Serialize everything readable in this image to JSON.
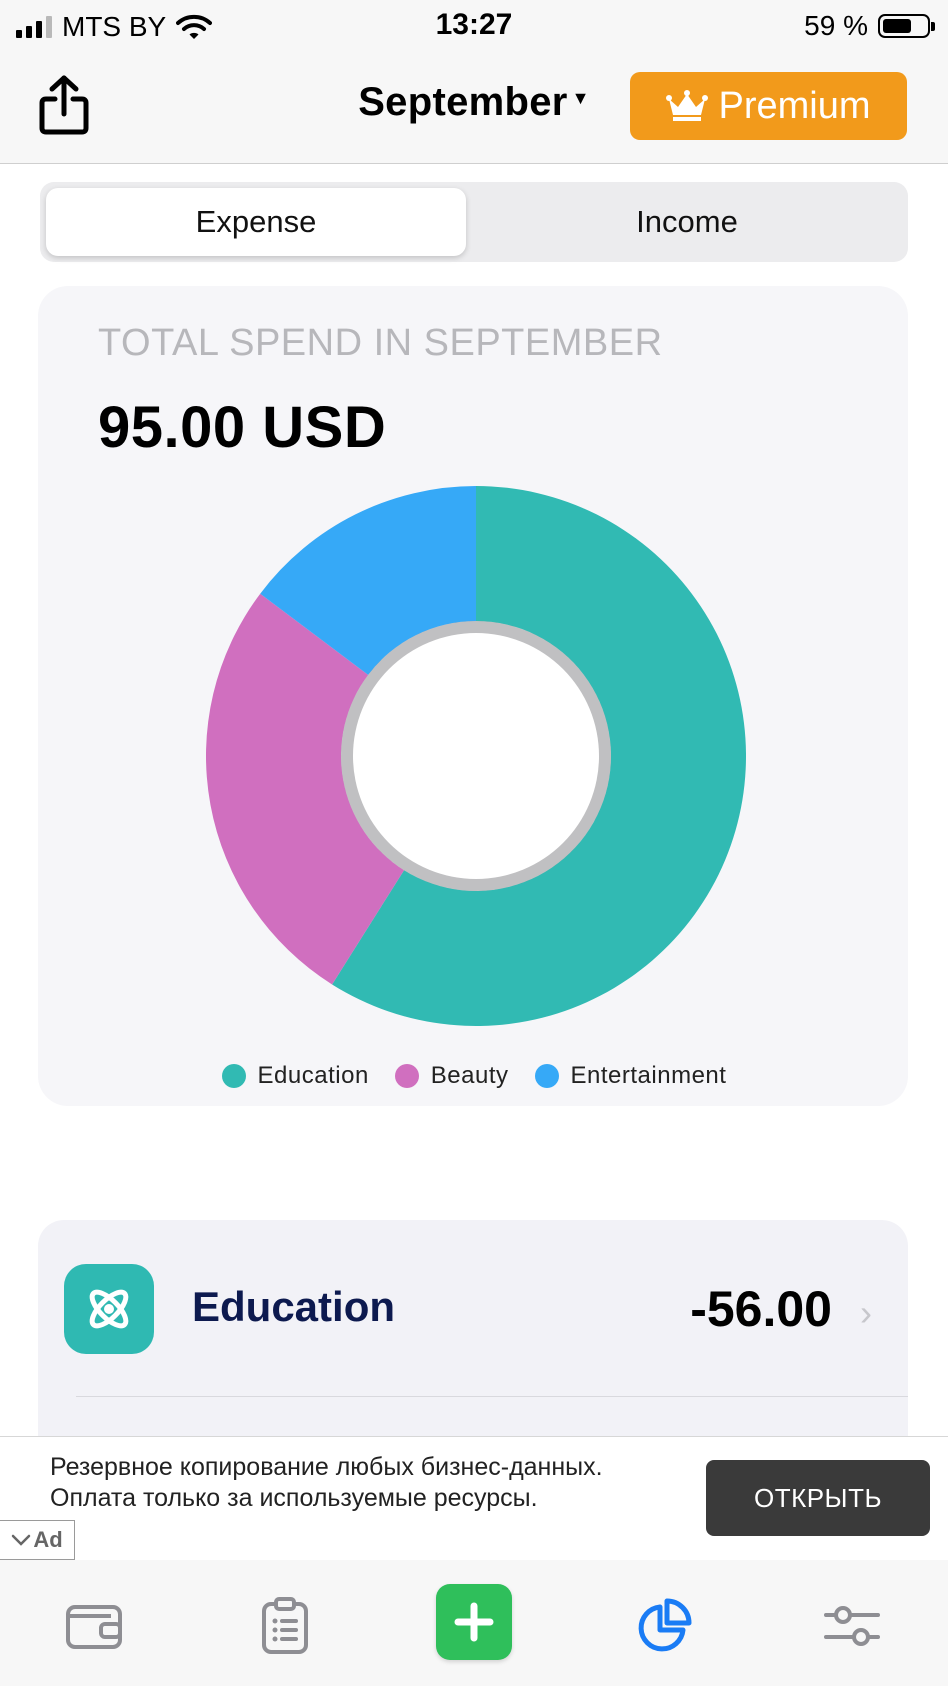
{
  "status_bar": {
    "carrier": "MTS BY",
    "time": "13:27",
    "battery": "59 %"
  },
  "header": {
    "month_title": "September",
    "premium_label": "Premium"
  },
  "segmented": {
    "tabs": [
      {
        "label": "Expense",
        "selected": true
      },
      {
        "label": "Income",
        "selected": false
      }
    ]
  },
  "summary": {
    "label": "TOTAL SPEND IN SEPTEMBER",
    "total": "95.00 USD"
  },
  "chart_data": {
    "type": "pie",
    "title": "",
    "donut": true,
    "categories": [
      "Education",
      "Beauty",
      "Entertainment"
    ],
    "values": [
      56,
      25,
      14
    ],
    "colors": [
      "#31bab3",
      "#d06fbf",
      "#36a9f7"
    ],
    "legend": "bottom"
  },
  "categories_list": [
    {
      "name": "Education",
      "amount": "-56.00",
      "icon": "atom-icon",
      "color": "#2fb9b2"
    }
  ],
  "ad": {
    "text": "Резервное копирование любых бизнес-данных. Оплата только за используемые ресурсы.",
    "button_label": "ОТКРЫТЬ",
    "badge": "Ad"
  },
  "tab_bar": {
    "icons": [
      "wallet-icon",
      "clipboard-icon",
      "plus-icon",
      "pie-chart-icon",
      "sliders-icon"
    ],
    "active_color": "#1a7cf5",
    "add_color": "#2fbf5b"
  }
}
